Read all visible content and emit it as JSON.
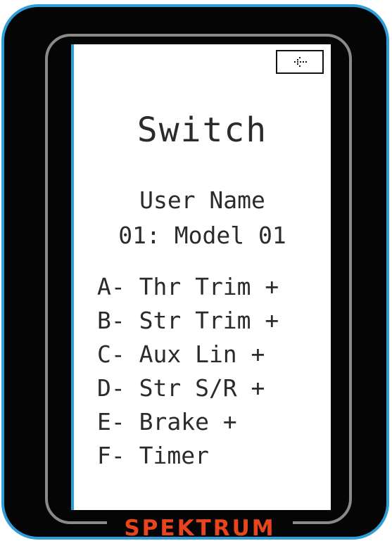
{
  "brand": {
    "name": "SPEKTRUM",
    "color": "#e8441e"
  },
  "colors": {
    "frame": "#2e9ed8",
    "bezel": "#050505",
    "ring": "#8a8a8a",
    "screen": "#ffffff",
    "text": "#2b2b2b"
  },
  "screen": {
    "back_icon": "back-arrow-icon",
    "title": "Switch",
    "user_label": "User Name",
    "model_name": "01: Model 01",
    "switches": [
      {
        "label": "A- Thr Trim +"
      },
      {
        "label": "B- Str Trim +"
      },
      {
        "label": "C- Aux Lin +"
      },
      {
        "label": "D- Str S/R +"
      },
      {
        "label": "E- Brake +"
      },
      {
        "label": "F- Timer"
      }
    ]
  }
}
